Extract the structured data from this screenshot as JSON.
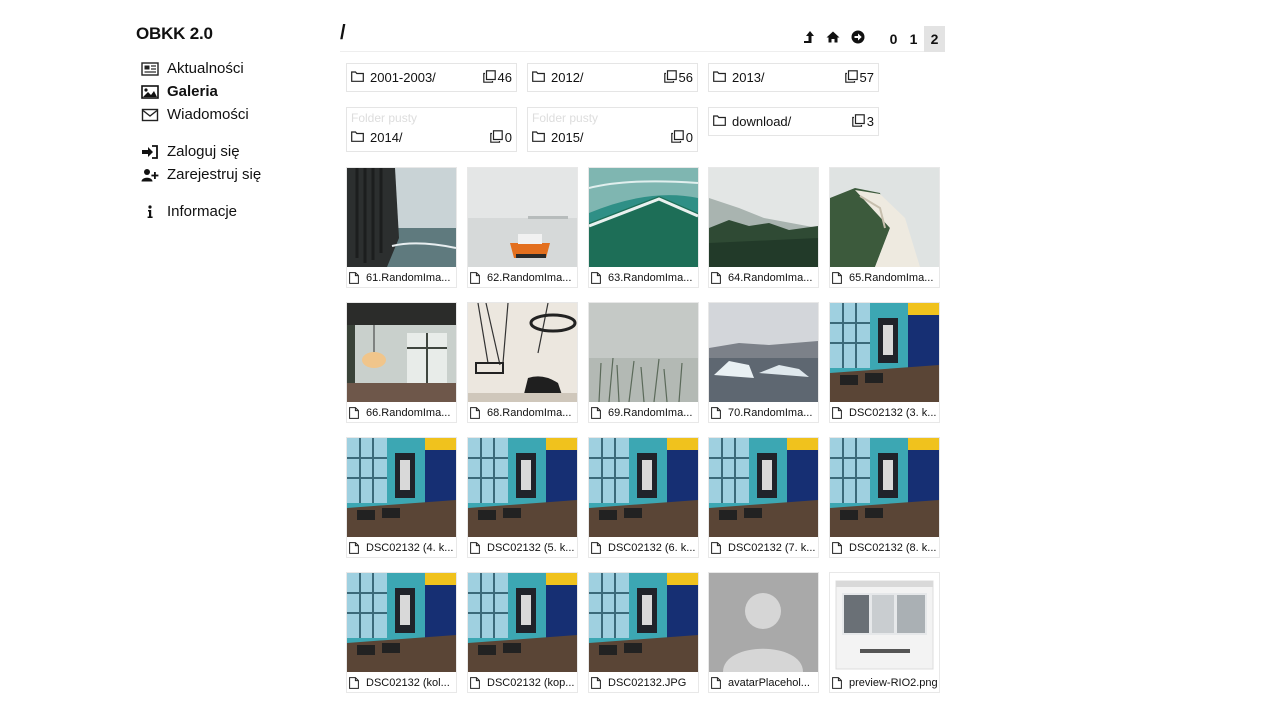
{
  "sidebar": {
    "brand": "OBKK 2.0",
    "items": [
      {
        "label": "Aktualności",
        "icon": "newspaper-icon"
      },
      {
        "label": "Galeria",
        "icon": "image-icon",
        "active": true
      },
      {
        "label": "Wiadomości",
        "icon": "envelope-icon"
      },
      {
        "label": "Zaloguj się",
        "icon": "sign-in-icon"
      },
      {
        "label": "Zarejestruj się",
        "icon": "user-plus-icon"
      },
      {
        "label": "Informacje",
        "icon": "info-icon"
      }
    ]
  },
  "header": {
    "path": "/",
    "tools": [
      "up-level-icon",
      "home-icon",
      "arrow-circle-right-icon"
    ],
    "sizes": [
      "0",
      "1",
      "2"
    ],
    "active_size": "2"
  },
  "folders": [
    {
      "name": "2001-2003/",
      "count": "46",
      "empty_label": ""
    },
    {
      "name": "2012/",
      "count": "56",
      "empty_label": ""
    },
    {
      "name": "2013/",
      "count": "57",
      "empty_label": ""
    },
    {
      "name": "2014/",
      "count": "0",
      "empty_label": "Folder pusty"
    },
    {
      "name": "2015/",
      "count": "0",
      "empty_label": "Folder pusty"
    },
    {
      "name": "download/",
      "count": "3",
      "empty_label": ""
    }
  ],
  "files": [
    {
      "label": "61.RandomIma..."
    },
    {
      "label": "62.RandomIma..."
    },
    {
      "label": "63.RandomIma..."
    },
    {
      "label": "64.RandomIma..."
    },
    {
      "label": "65.RandomIma..."
    },
    {
      "label": "66.RandomIma..."
    },
    {
      "label": "68.RandomIma..."
    },
    {
      "label": "69.RandomIma..."
    },
    {
      "label": "70.RandomIma..."
    },
    {
      "label": "DSC02132 (3. k..."
    },
    {
      "label": "DSC02132 (4. k..."
    },
    {
      "label": "DSC02132 (5. k..."
    },
    {
      "label": "DSC02132 (6. k..."
    },
    {
      "label": "DSC02132 (7. k..."
    },
    {
      "label": "DSC02132 (8. k..."
    },
    {
      "label": "DSC02132 (kol..."
    },
    {
      "label": "DSC02132 (kop..."
    },
    {
      "label": "DSC02132.JPG"
    },
    {
      "label": "avatarPlacehol..."
    },
    {
      "label": "preview-RIO2.png"
    }
  ]
}
